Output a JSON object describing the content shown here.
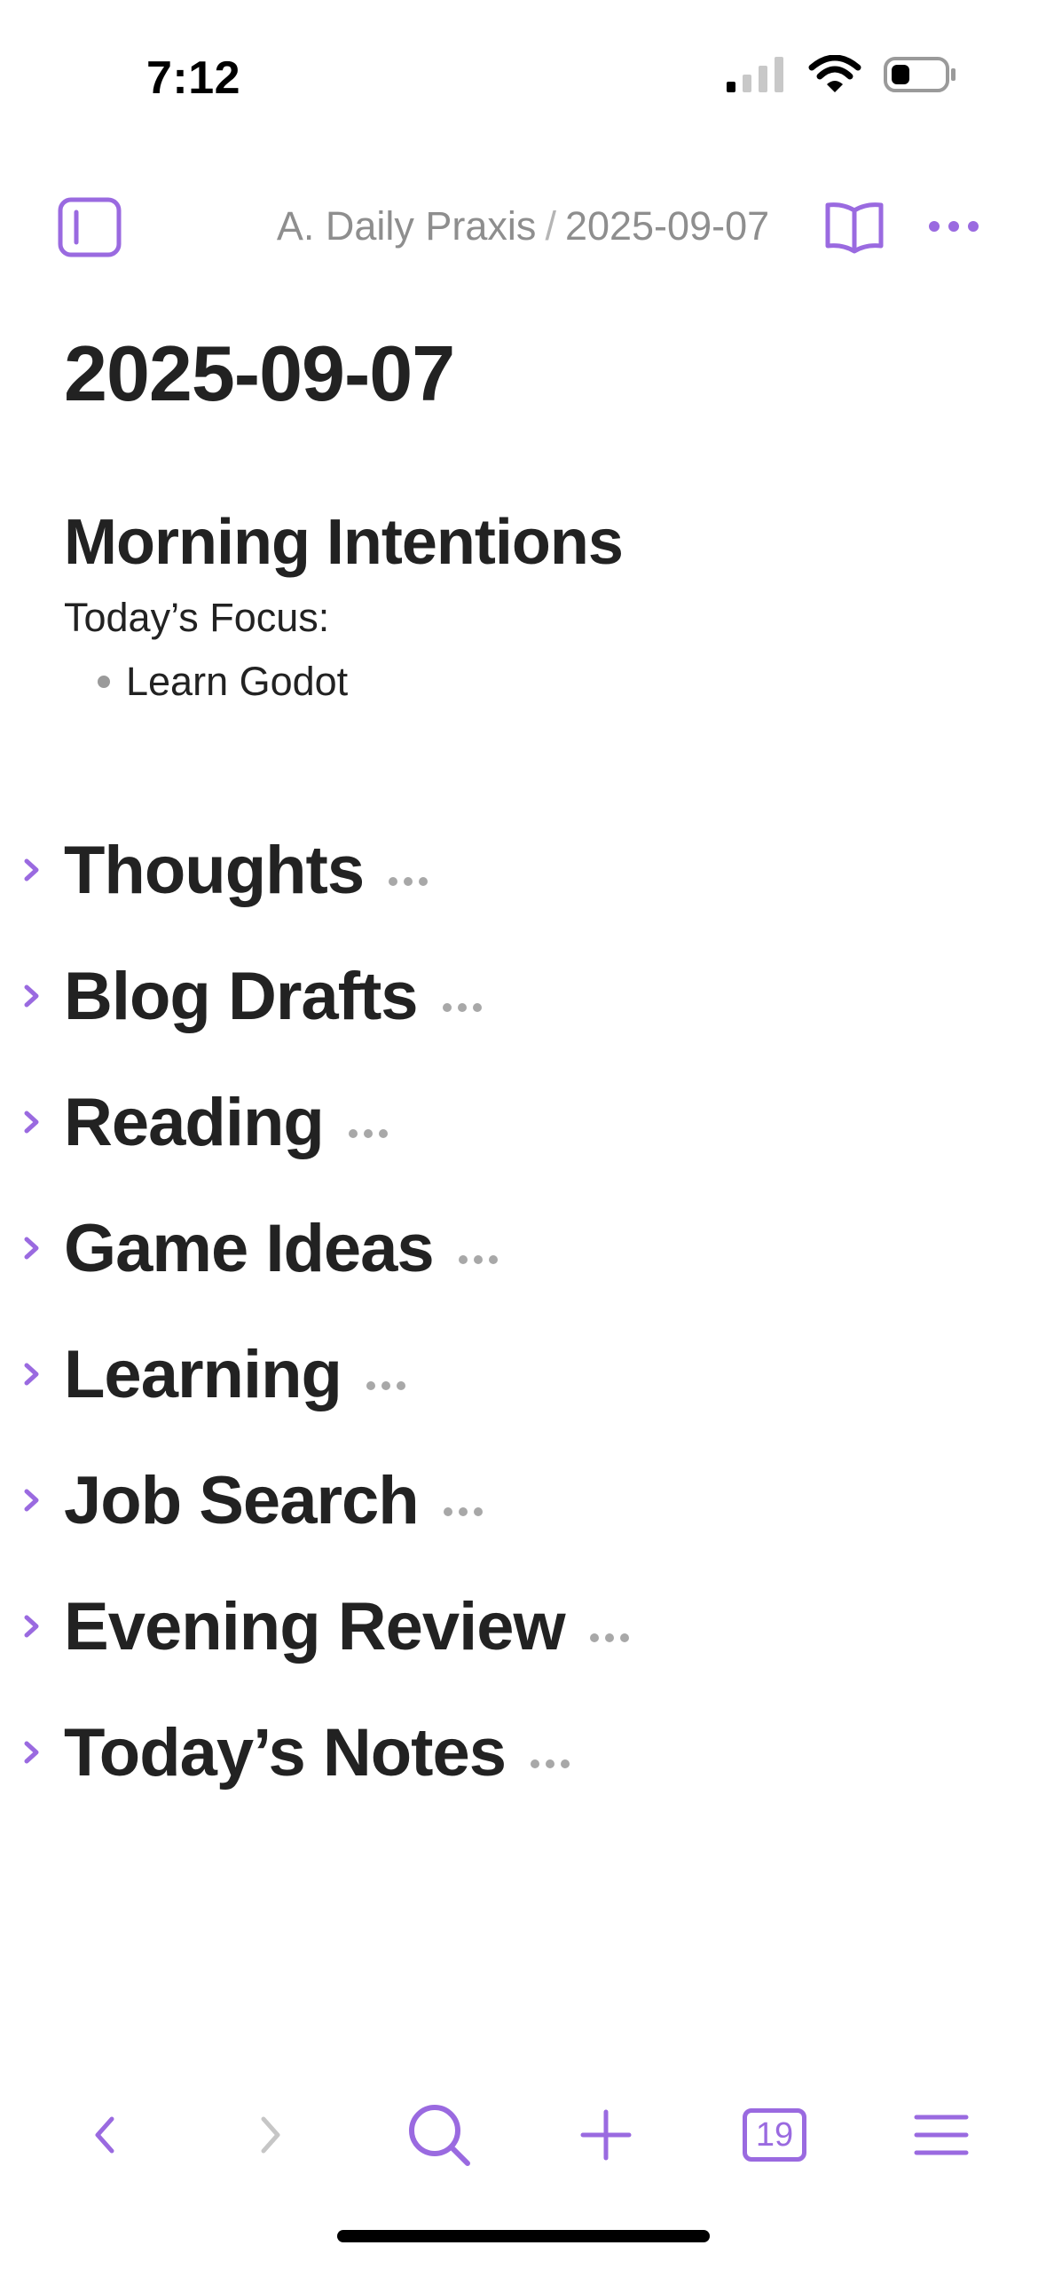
{
  "status": {
    "time": "7:12"
  },
  "breadcrumb": {
    "parent": "A. Daily Praxis",
    "separator": "/",
    "current": "2025-09-07"
  },
  "document": {
    "title": "2025-09-07",
    "morning": {
      "heading": "Morning Intentions",
      "focus_label": "Today’s Focus:",
      "focus_items": [
        "Learn Godot"
      ]
    },
    "collapsed_sections": [
      "Thoughts",
      "Blog Drafts",
      "Reading",
      "Game Ideas",
      "Learning",
      "Job Search",
      "Evening Review",
      "Today’s Notes"
    ]
  },
  "toolbar": {
    "calendar_day": "19"
  },
  "icons": {
    "sidebar": "sidebar-toggle-icon",
    "reader": "book-open-icon",
    "more": "ellipsis-icon",
    "back": "chevron-left-icon",
    "forward": "chevron-right-icon",
    "search": "search-icon",
    "add": "plus-icon",
    "calendar": "calendar-icon",
    "menu": "hamburger-menu-icon"
  },
  "colors": {
    "accent": "#9a6ae0",
    "muted": "#8e8e8e",
    "text": "#222222"
  }
}
